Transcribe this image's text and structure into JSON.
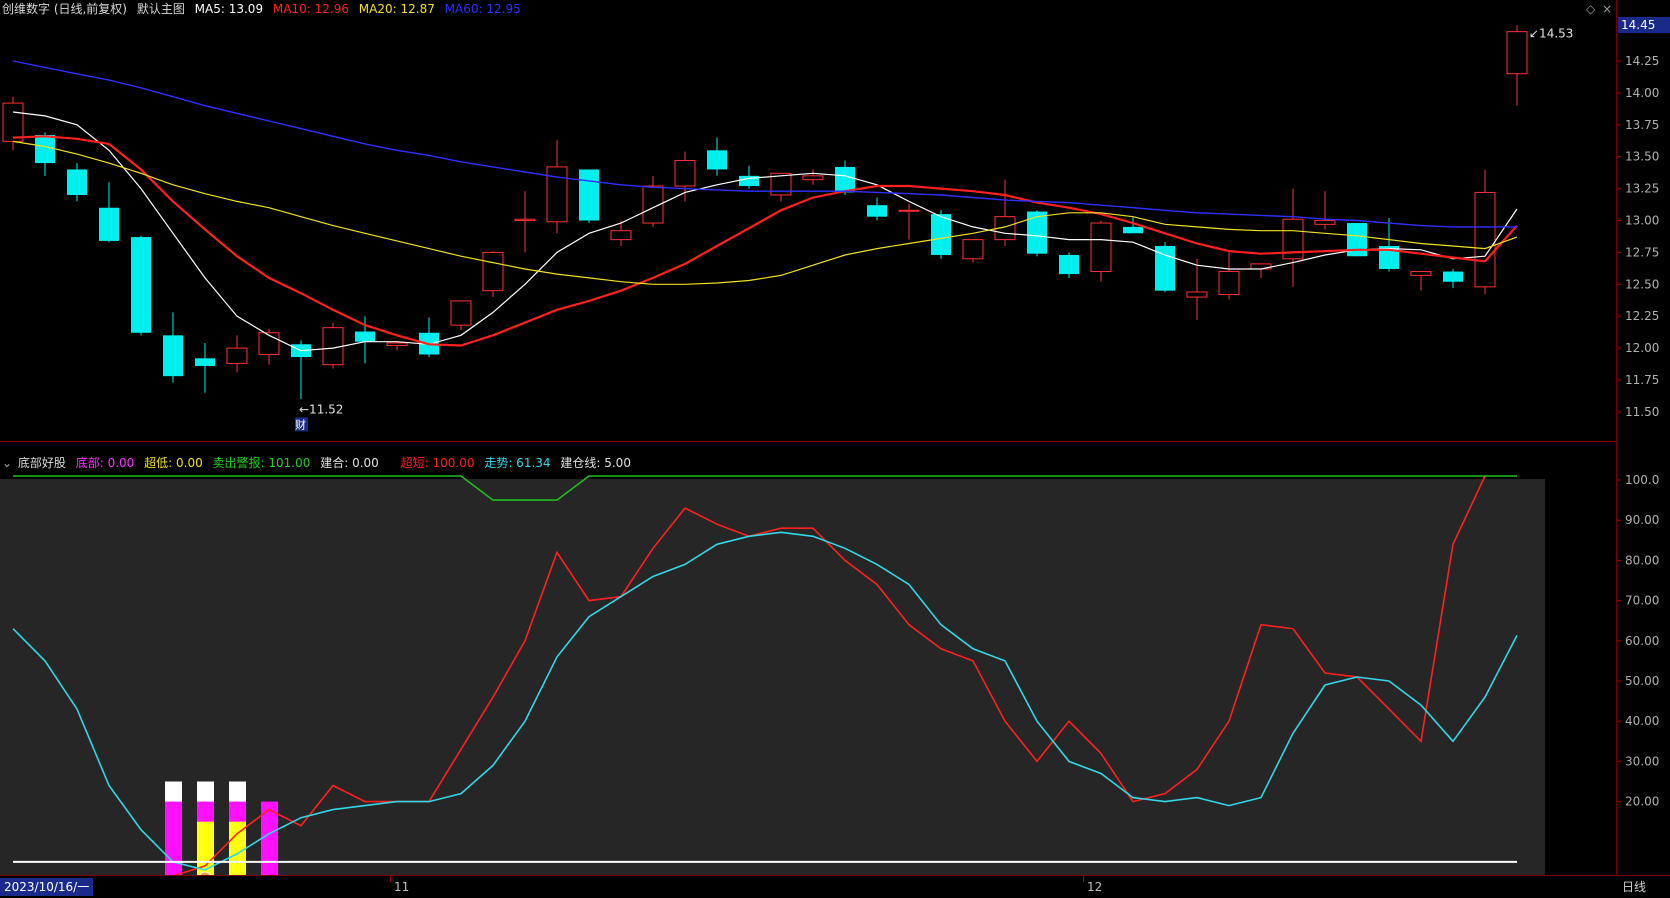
{
  "header": {
    "title": "创维数字 (日线,前复权)",
    "main_chart_name": "默认主图",
    "ma5_label": "MA5: 13.09",
    "ma10_label": "MA10: 12.96",
    "ma20_label": "MA20: 12.87",
    "ma60_label": "MA60: 12.95",
    "colors": {
      "ma5": "#ffffff",
      "ma10": "#ff2020",
      "ma20": "#f0e020",
      "ma60": "#3030ff"
    }
  },
  "price_axis": {
    "current_price_tag": "14.45",
    "ticks": [
      "14.25",
      "14.00",
      "13.75",
      "13.50",
      "13.25",
      "13.00",
      "12.75",
      "12.50",
      "12.25",
      "12.00",
      "11.75",
      "11.50"
    ],
    "range": [
      11.45,
      14.6
    ]
  },
  "annotations": {
    "high_label": "14.53",
    "low_label": "11.52",
    "finance_marker": "财"
  },
  "chart_data": [
    {
      "type": "candlestick",
      "title": "创维数字 (日线,前复权)",
      "ylim": [
        11.45,
        14.6
      ],
      "candles": [
        {
          "o": 13.62,
          "h": 13.97,
          "l": 13.55,
          "c": 13.92
        },
        {
          "o": 13.67,
          "h": 13.69,
          "l": 13.35,
          "c": 13.45
        },
        {
          "o": 13.4,
          "h": 13.45,
          "l": 13.15,
          "c": 13.2
        },
        {
          "o": 13.1,
          "h": 13.3,
          "l": 12.83,
          "c": 12.84
        },
        {
          "o": 12.87,
          "h": 12.88,
          "l": 12.1,
          "c": 12.12
        },
        {
          "o": 12.1,
          "h": 12.28,
          "l": 11.73,
          "c": 11.78
        },
        {
          "o": 11.92,
          "h": 12.04,
          "l": 11.65,
          "c": 11.86
        },
        {
          "o": 11.88,
          "h": 12.1,
          "l": 11.81,
          "c": 12.0
        },
        {
          "o": 11.95,
          "h": 12.15,
          "l": 11.87,
          "c": 12.12
        },
        {
          "o": 12.03,
          "h": 12.06,
          "l": 11.6,
          "c": 11.93
        },
        {
          "o": 11.87,
          "h": 12.2,
          "l": 11.84,
          "c": 12.16
        },
        {
          "o": 12.13,
          "h": 12.25,
          "l": 11.88,
          "c": 12.05
        },
        {
          "o": 12.02,
          "h": 12.05,
          "l": 11.98,
          "c": 12.04
        },
        {
          "o": 12.12,
          "h": 12.24,
          "l": 11.93,
          "c": 11.95
        },
        {
          "o": 12.18,
          "h": 12.33,
          "l": 12.14,
          "c": 12.37
        },
        {
          "o": 12.45,
          "h": 12.76,
          "l": 12.4,
          "c": 12.75
        },
        {
          "o": 13.0,
          "h": 13.23,
          "l": 12.75,
          "c": 13.01
        },
        {
          "o": 12.99,
          "h": 13.63,
          "l": 12.9,
          "c": 13.42
        },
        {
          "o": 13.4,
          "h": 13.4,
          "l": 12.98,
          "c": 13.0
        },
        {
          "o": 12.85,
          "h": 13.0,
          "l": 12.8,
          "c": 12.92
        },
        {
          "o": 12.98,
          "h": 13.35,
          "l": 12.95,
          "c": 13.27
        },
        {
          "o": 13.27,
          "h": 13.54,
          "l": 13.15,
          "c": 13.47
        },
        {
          "o": 13.55,
          "h": 13.65,
          "l": 13.35,
          "c": 13.4
        },
        {
          "o": 13.35,
          "h": 13.43,
          "l": 13.25,
          "c": 13.27
        },
        {
          "o": 13.2,
          "h": 13.37,
          "l": 13.15,
          "c": 13.37
        },
        {
          "o": 13.32,
          "h": 13.4,
          "l": 13.28,
          "c": 13.35
        },
        {
          "o": 13.42,
          "h": 13.47,
          "l": 13.2,
          "c": 13.22
        },
        {
          "o": 13.12,
          "h": 13.18,
          "l": 13.0,
          "c": 13.03
        },
        {
          "o": 13.08,
          "h": 13.13,
          "l": 12.85,
          "c": 13.08
        },
        {
          "o": 13.05,
          "h": 13.08,
          "l": 12.7,
          "c": 12.73
        },
        {
          "o": 12.7,
          "h": 12.85,
          "l": 12.67,
          "c": 12.85
        },
        {
          "o": 12.85,
          "h": 13.32,
          "l": 12.8,
          "c": 13.03
        },
        {
          "o": 13.07,
          "h": 13.08,
          "l": 12.72,
          "c": 12.74
        },
        {
          "o": 12.73,
          "h": 12.75,
          "l": 12.55,
          "c": 12.58
        },
        {
          "o": 12.6,
          "h": 13.0,
          "l": 12.52,
          "c": 12.98
        },
        {
          "o": 12.95,
          "h": 13.03,
          "l": 12.9,
          "c": 12.9
        },
        {
          "o": 12.8,
          "h": 12.83,
          "l": 12.44,
          "c": 12.45
        },
        {
          "o": 12.4,
          "h": 12.7,
          "l": 12.22,
          "c": 12.44
        },
        {
          "o": 12.42,
          "h": 12.75,
          "l": 12.38,
          "c": 12.6
        },
        {
          "o": 12.62,
          "h": 12.65,
          "l": 12.55,
          "c": 12.66
        },
        {
          "o": 12.7,
          "h": 13.25,
          "l": 12.48,
          "c": 13.01
        },
        {
          "o": 12.97,
          "h": 13.23,
          "l": 12.93,
          "c": 13.0
        },
        {
          "o": 12.98,
          "h": 12.98,
          "l": 12.72,
          "c": 12.72
        },
        {
          "o": 12.8,
          "h": 13.02,
          "l": 12.6,
          "c": 12.62
        },
        {
          "o": 12.57,
          "h": 12.6,
          "l": 12.45,
          "c": 12.6
        },
        {
          "o": 12.6,
          "h": 12.62,
          "l": 12.47,
          "c": 12.52
        },
        {
          "o": 12.48,
          "h": 13.4,
          "l": 12.42,
          "c": 13.22
        },
        {
          "o": 14.15,
          "h": 14.53,
          "l": 13.9,
          "c": 14.48
        }
      ],
      "series": [
        {
          "name": "MA5",
          "color": "#ffffff",
          "values": [
            13.85,
            13.82,
            13.75,
            13.55,
            13.25,
            12.9,
            12.55,
            12.25,
            12.1,
            11.98,
            12.0,
            12.05,
            12.05,
            12.03,
            12.1,
            12.28,
            12.5,
            12.75,
            12.9,
            12.98,
            13.1,
            13.22,
            13.28,
            13.33,
            13.35,
            13.37,
            13.35,
            13.28,
            13.15,
            13.03,
            12.95,
            12.9,
            12.88,
            12.85,
            12.85,
            12.83,
            12.73,
            12.65,
            12.62,
            12.62,
            12.67,
            12.73,
            12.77,
            12.78,
            12.77,
            12.7,
            12.72,
            13.09
          ]
        },
        {
          "name": "MA10",
          "color": "#ff2020",
          "values": [
            13.65,
            13.66,
            13.64,
            13.6,
            13.4,
            13.15,
            12.93,
            12.72,
            12.55,
            12.43,
            12.3,
            12.18,
            12.1,
            12.03,
            12.02,
            12.1,
            12.2,
            12.3,
            12.37,
            12.45,
            12.55,
            12.66,
            12.8,
            12.94,
            13.08,
            13.18,
            13.23,
            13.27,
            13.27,
            13.25,
            13.23,
            13.2,
            13.14,
            13.1,
            13.05,
            12.98,
            12.9,
            12.82,
            12.76,
            12.74,
            12.75,
            12.76,
            12.77,
            12.77,
            12.74,
            12.71,
            12.68,
            12.96
          ]
        },
        {
          "name": "MA20",
          "color": "#f0e020",
          "values": [
            13.62,
            13.58,
            13.52,
            13.45,
            13.37,
            13.28,
            13.21,
            13.15,
            13.1,
            13.03,
            12.96,
            12.9,
            12.84,
            12.78,
            12.72,
            12.67,
            12.62,
            12.58,
            12.55,
            12.52,
            12.5,
            12.5,
            12.51,
            12.53,
            12.57,
            12.65,
            12.73,
            12.78,
            12.82,
            12.86,
            12.9,
            12.95,
            13.03,
            13.06,
            13.06,
            13.03,
            12.97,
            12.95,
            12.93,
            12.92,
            12.92,
            12.9,
            12.88,
            12.85,
            12.82,
            12.8,
            12.78,
            12.87
          ]
        },
        {
          "name": "MA60",
          "color": "#3030ff",
          "values": [
            14.25,
            14.2,
            14.15,
            14.1,
            14.04,
            13.97,
            13.9,
            13.84,
            13.78,
            13.72,
            13.66,
            13.6,
            13.55,
            13.51,
            13.46,
            13.42,
            13.38,
            13.34,
            13.31,
            13.28,
            13.26,
            13.25,
            13.24,
            13.23,
            13.23,
            13.23,
            13.23,
            13.22,
            13.21,
            13.2,
            13.18,
            13.16,
            13.15,
            13.14,
            13.12,
            13.1,
            13.08,
            13.06,
            13.05,
            13.04,
            13.03,
            13.01,
            13.0,
            12.98,
            12.96,
            12.95,
            12.95,
            12.95
          ]
        }
      ]
    },
    {
      "type": "line",
      "title": "底部好股",
      "ylim": [
        0,
        102
      ],
      "legend": [
        "底部: 0.00",
        "超低: 0.00",
        "卖出警报: 101.00",
        "建合: 0.00",
        "超短: 100.00",
        "走势: 61.34",
        "建仓线: 5.00"
      ],
      "series": [
        {
          "name": "超短",
          "color": "#ff2020",
          "values": [
            null,
            null,
            null,
            null,
            null,
            1.5,
            4,
            12,
            18,
            14,
            24,
            20,
            20,
            20,
            33,
            46,
            60,
            82,
            70,
            71,
            83,
            93,
            89,
            86,
            88,
            88,
            80,
            74,
            64,
            58,
            55,
            40,
            30,
            40,
            32,
            20,
            22,
            28,
            40,
            64,
            63,
            52,
            51,
            43,
            35,
            84,
            101
          ]
        },
        {
          "name": "走势",
          "color": "#30d8e8",
          "values": [
            63,
            55,
            43,
            24,
            13,
            5,
            3,
            7,
            12,
            16,
            18,
            19,
            20,
            20,
            22,
            29,
            40,
            56,
            66,
            71,
            76,
            79,
            84,
            86,
            87,
            86,
            83,
            79,
            74,
            64,
            58,
            55,
            40,
            30,
            27,
            21,
            20,
            21,
            19,
            21,
            37,
            49,
            51,
            50,
            44,
            35,
            46,
            61.34
          ]
        },
        {
          "name": "卖出警报",
          "color": "#20c020",
          "values": [
            101,
            101,
            101,
            101,
            101,
            101,
            101,
            101,
            101,
            101,
            101,
            101,
            101,
            101,
            101,
            95,
            95,
            95,
            101,
            101,
            101,
            101,
            101,
            101,
            101,
            101,
            101,
            101,
            101,
            101,
            101,
            101,
            101,
            101,
            101,
            101,
            101,
            101,
            101,
            101,
            101,
            101,
            101,
            101,
            101,
            101,
            101,
            101
          ]
        },
        {
          "name": "建仓线",
          "color": "#ffffff",
          "values": [
            5,
            5,
            5,
            5,
            5,
            5,
            5,
            5,
            5,
            5,
            5,
            5,
            5,
            5,
            5,
            5,
            5,
            5,
            5,
            5,
            5,
            5,
            5,
            5,
            5,
            5,
            5,
            5,
            5,
            5,
            5,
            5,
            5,
            5,
            5,
            5,
            5,
            5,
            5,
            5,
            5,
            5,
            5,
            5,
            5,
            5,
            5,
            5
          ]
        }
      ],
      "bars": [
        {
          "index": 5,
          "white": 25,
          "magenta": 20,
          "yellow": 0
        },
        {
          "index": 6,
          "white": 25,
          "magenta": 20,
          "yellow": 15
        },
        {
          "index": 7,
          "white": 25,
          "magenta": 20,
          "yellow": 15
        },
        {
          "index": 8,
          "white": 0,
          "magenta": 20,
          "yellow": 0
        }
      ],
      "yticks": [
        "100.0",
        "90.00",
        "80.00",
        "70.00",
        "60.00",
        "50.00",
        "40.00",
        "30.00",
        "20.00"
      ]
    }
  ],
  "indicator": {
    "name": "底部好股",
    "items": [
      {
        "label": "底部: 0.00",
        "color": "#ff30ff"
      },
      {
        "label": "超低: 0.00",
        "color": "#f0e020"
      },
      {
        "label": "卖出警报: 101.00",
        "color": "#20d020"
      },
      {
        "label": "建合: 0.00",
        "color": "#e0e0e0"
      },
      {
        "label": "超短: 100.00",
        "color": "#ff2020"
      },
      {
        "label": "走势: 61.34",
        "color": "#30d8e8"
      },
      {
        "label": "建仓线: 5.00",
        "color": "#e0e0e0"
      }
    ]
  },
  "time_axis": {
    "start_date": "2023/10/16/一",
    "month_11": "11",
    "month_12": "12",
    "period": "日线"
  }
}
